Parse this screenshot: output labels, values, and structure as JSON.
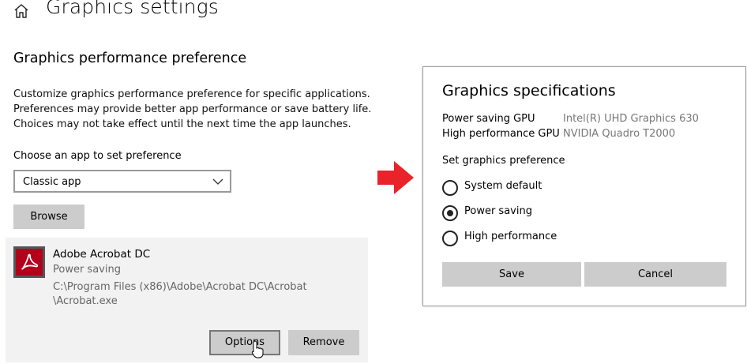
{
  "page": {
    "title": "Graphics settings",
    "home_icon": "home-icon"
  },
  "preference": {
    "section_title": "Graphics performance preference",
    "description": [
      "Customize graphics performance preference for specific applications.",
      "Preferences may provide better app performance or save battery life.",
      "Choices may not take effect until the next time the app launches."
    ],
    "choose_label": "Choose an app to set preference",
    "app_type_selected": "Classic app",
    "browse_label": "Browse"
  },
  "app": {
    "name": "Adobe Acrobat DC",
    "preference": "Power saving",
    "path_line1": "C:\\Program Files (x86)\\Adobe\\Acrobat DC\\Acrobat",
    "path_line2": "\\Acrobat.exe",
    "options_label": "Options",
    "remove_label": "Remove",
    "icon": "acrobat-icon"
  },
  "dialog": {
    "title": "Graphics specifications",
    "specs": [
      {
        "label": "Power saving GPU",
        "value": "Intel(R) UHD Graphics 630"
      },
      {
        "label": "High performance GPU",
        "value": "NVIDIA Quadro T2000"
      }
    ],
    "set_pref_label": "Set graphics preference",
    "radio_options": [
      {
        "label": "System default",
        "selected": false
      },
      {
        "label": "Power saving",
        "selected": true
      },
      {
        "label": "High performance",
        "selected": false
      }
    ],
    "save_label": "Save",
    "cancel_label": "Cancel"
  },
  "colors": {
    "arrow": "#e8232a",
    "button_bg": "#cccccc",
    "acrobat_red": "#b3001b"
  }
}
